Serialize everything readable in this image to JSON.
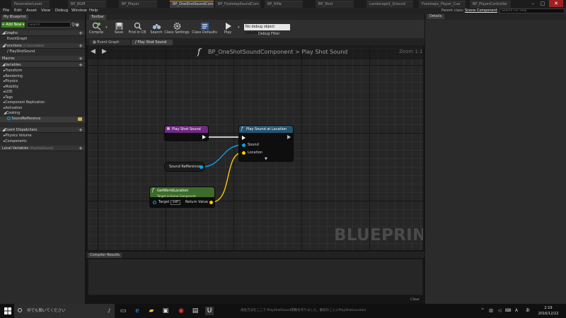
{
  "doc_tabs": [
    "ParameterLevel",
    "BP_BGM",
    "BP_Player",
    "BP_OneShotSoundCom",
    "BP_FootstepSoundCom",
    "BP_Rifle",
    "BP_Shot",
    "Landscape1_Ground",
    "Footsteps_Player_Cue",
    "BP_PlayerController"
  ],
  "menu": [
    "File",
    "Edit",
    "Asset",
    "View",
    "Debug",
    "Window",
    "Help"
  ],
  "parent_class_label": "Parent class:",
  "parent_class_value": "Scene Component",
  "help_search_placeholder": "Search For Help",
  "left": {
    "tab": "My Blueprint",
    "add_new": "+ Add New ▾",
    "search_placeholder": "Search",
    "graphs": "Graphs",
    "event_graph": "EventGraph",
    "functions": "Functions",
    "functions_sub": "(1 Overridable)",
    "function_item": "PlayShotSound",
    "macros": "Macros",
    "variables": "Variables",
    "var_categories": [
      "Transform",
      "Rendering",
      "Physics",
      "Mobility",
      "LOD",
      "Tags",
      "Component Replication",
      "Activation",
      "Cooking"
    ],
    "sound_var": "SoundRefference",
    "event_dispatchers": "Event Dispatchers",
    "dispatch_categories": [
      "Physics Volume",
      "Components"
    ],
    "local_variables": "Local Variables",
    "local_variables_sub": "(PlayShotSound)"
  },
  "toolbar": {
    "tab": "Toolbar",
    "compile": "Compile",
    "save": "Save",
    "find": "Find in CB",
    "search": "Search",
    "class_settings": "Class Settings",
    "class_defaults": "Class Defaults",
    "play": "Play",
    "debug_select": "No debug object selected ▾",
    "debug_filter": "Debug Filter"
  },
  "graph_tabs": [
    "Event Graph",
    "Play Shot Sound"
  ],
  "graph": {
    "glyph": "f",
    "breadcrumb": "BP_OneShotSoundComponent  >  Play Shot Sound",
    "zoom": "Zoom 1:1",
    "watermark": "BLUEPRINT",
    "entry_node": "Play Shot Sound",
    "play_node": "Play Sound at Location",
    "play_pin_sound": "Sound",
    "play_pin_location": "Location",
    "var_node": "Sound Refference",
    "loc_node": "GetWorldLocation",
    "loc_sub": "Target is Scene Component",
    "loc_target": "Target",
    "loc_self": "self",
    "loc_return": "Return Value"
  },
  "compiler": {
    "tab": "Compiler Results",
    "clear": "Clear"
  },
  "right": {
    "tab": "Details"
  },
  "taskbar": {
    "search": "何でも聞いてください",
    "notice": "再生方法をここで PlayShotSound関数を作りました。最初のことにPlayShotLocation",
    "time": "2:19",
    "date": "2016/12/22"
  },
  "colors": {
    "exec": "#ffffff",
    "object_pin": "#00a8f2",
    "vector_pin": "#fdc800",
    "pure_node": "#3d6b2a",
    "event_node": "#7e2a8f",
    "call_node": "#2a5070"
  }
}
